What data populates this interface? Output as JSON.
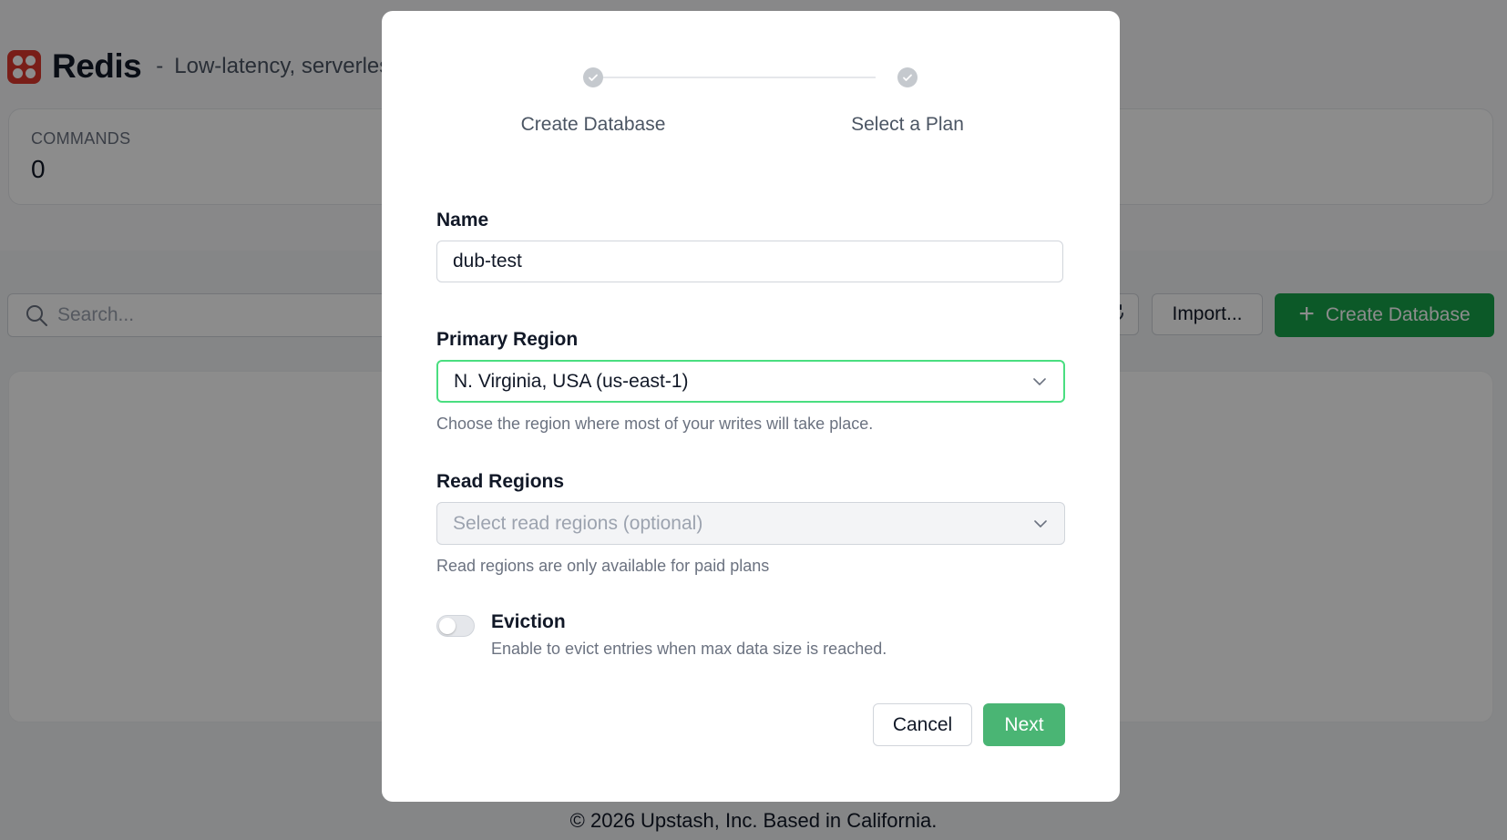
{
  "app": {
    "title": "Redis",
    "separator": "-",
    "subtitle": "Low-latency, serverless key-value database"
  },
  "stats": {
    "commands_label": "COMMANDS",
    "commands_value": "0"
  },
  "toolbar": {
    "search_placeholder": "Search...",
    "import_label": "Import...",
    "create_label": "Create Database",
    "refresh_icon": "refresh-icon",
    "search_icon": "search-icon"
  },
  "footer": {
    "text": "© 2026 Upstash, Inc. Based in California."
  },
  "modal": {
    "steps": [
      {
        "label": "Create Database",
        "state": "complete"
      },
      {
        "label": "Select a Plan",
        "state": "complete"
      }
    ],
    "name": {
      "label": "Name",
      "value": "dub-test"
    },
    "primary_region": {
      "label": "Primary Region",
      "value": "N. Virginia, USA (us-east-1)",
      "help": "Choose the region where most of your writes will take place."
    },
    "read_regions": {
      "label": "Read Regions",
      "placeholder": "Select read regions (optional)",
      "help": "Read regions are only available for paid plans"
    },
    "eviction": {
      "label": "Eviction",
      "description": "Enable to evict entries when max data size is reached.",
      "enabled": false
    },
    "cancel_label": "Cancel",
    "next_label": "Next"
  },
  "colors": {
    "accent_green": "#16a34a",
    "next_button": "#4ab574",
    "redis_red": "#dc382c",
    "focus_border": "#4ade80"
  }
}
